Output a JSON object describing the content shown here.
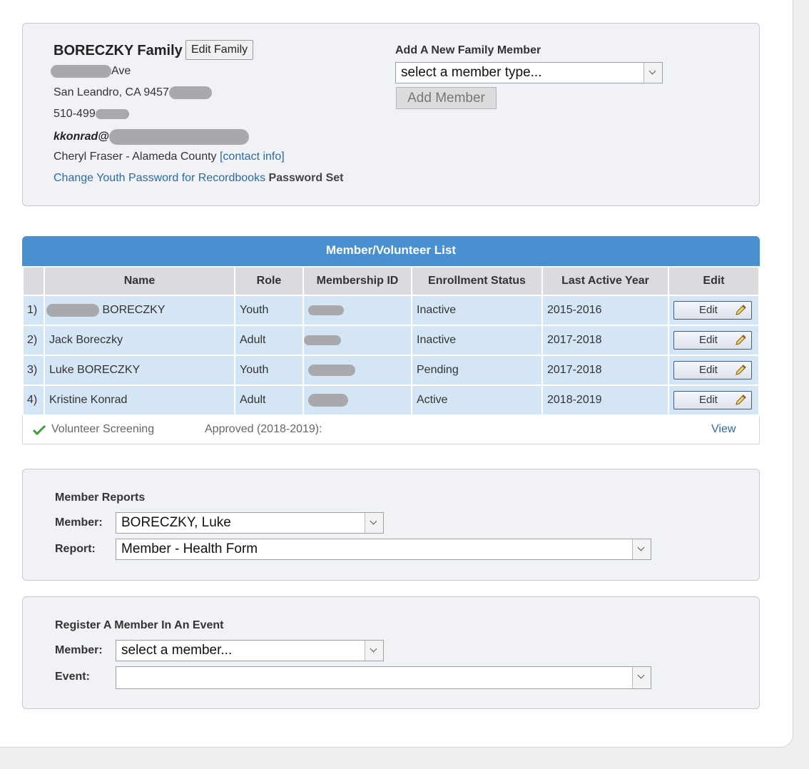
{
  "family": {
    "title": "BORECZKY Family",
    "edit_button": "Edit Family",
    "address_suffix": "Ave",
    "city_line": "San Leandro, CA 9457",
    "phone_prefix": "510-499",
    "email_prefix": "kkonrad@",
    "leader": "Cheryl Fraser - Alameda County",
    "contact_link": "[contact info]",
    "youth_password_link": "Change Youth Password for Recordbooks",
    "password_status": "Password Set"
  },
  "add_member": {
    "label": "Add A New Family Member",
    "select_value": "select a member type...",
    "button": "Add Member"
  },
  "member_list": {
    "title": "Member/Volunteer List",
    "columns": [
      "",
      "Name",
      "Role",
      "Membership ID",
      "Enrollment Status",
      "Last Active Year",
      "Edit"
    ],
    "rows": [
      {
        "num": "1)",
        "name": "BORECZKY",
        "role": "Youth",
        "status": "Inactive",
        "year": "2015-2016",
        "edit": "Edit"
      },
      {
        "num": "2)",
        "name": "Jack Boreczky",
        "role": "Adult",
        "status": "Inactive",
        "year": "2017-2018",
        "edit": "Edit"
      },
      {
        "num": "3)",
        "name": "Luke BORECZKY",
        "role": "Youth",
        "status": "Pending",
        "year": "2017-2018",
        "edit": "Edit"
      },
      {
        "num": "4)",
        "name": "Kristine Konrad",
        "role": "Adult",
        "status": "Active",
        "year": "2018-2019",
        "edit": "Edit"
      }
    ],
    "volunteer": {
      "label": "Volunteer Screening",
      "status": "Approved (2018-2019):",
      "view": "View"
    }
  },
  "reports": {
    "title": "Member Reports",
    "member_label": "Member:",
    "member_value": "BORECZKY, Luke",
    "report_label": "Report:",
    "report_value": "Member - Health Form"
  },
  "event": {
    "title": "Register A Member In An Event",
    "member_label": "Member:",
    "member_value": "select a member...",
    "event_label": "Event:",
    "event_value": ""
  },
  "colors": {
    "header_blue": "#4a8fd0",
    "row_blue": "#d4e6f5",
    "link": "#2d6aa3"
  }
}
